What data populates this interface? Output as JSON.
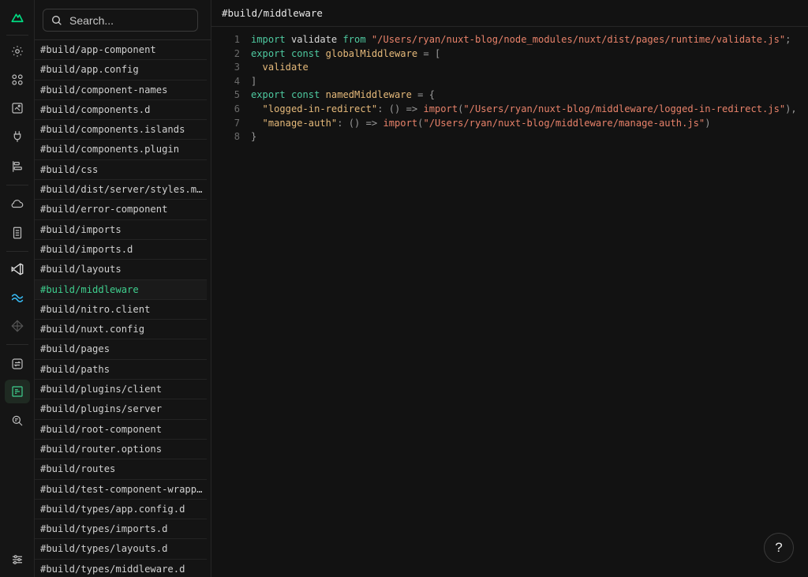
{
  "rail": {
    "icons": [
      "nuxt-logo-icon",
      "settings-icon",
      "components-icon",
      "pages-icon",
      "plugins-icon",
      "timeline-icon",
      "cloud-icon",
      "book-icon",
      "vscode-icon",
      "tailwind-icon",
      "diamond-icon",
      "transfer-icon",
      "virtual-files-icon",
      "inspect-icon",
      "sliders-icon"
    ],
    "accent": "#00dc82"
  },
  "search": {
    "placeholder": "Search..."
  },
  "files": [
    "#build/app-component",
    "#build/app.config",
    "#build/component-names",
    "#build/components.d",
    "#build/components.islands",
    "#build/components.plugin",
    "#build/css",
    "#build/dist/server/styles.mjs",
    "#build/error-component",
    "#build/imports",
    "#build/imports.d",
    "#build/layouts",
    "#build/middleware",
    "#build/nitro.client",
    "#build/nuxt.config",
    "#build/pages",
    "#build/paths",
    "#build/plugins/client",
    "#build/plugins/server",
    "#build/root-component",
    "#build/router.options",
    "#build/routes",
    "#build/test-component-wrapper",
    "#build/types/app.config.d",
    "#build/types/imports.d",
    "#build/types/layouts.d",
    "#build/types/middleware.d"
  ],
  "active_file_index": 12,
  "editor": {
    "title": "#build/middleware",
    "line_numbers": [
      "1",
      "2",
      "3",
      "4",
      "5",
      "6",
      "7",
      "8"
    ],
    "l1": {
      "k1": "import",
      "a": " validate ",
      "k2": "from",
      "s": " \"/Users/ryan/nuxt-blog/node_modules/nuxt/dist/pages/runtime/validate.js\"",
      "p": ";"
    },
    "l2": {
      "k1": "export",
      "k2": " const",
      "f": " globalMiddleware",
      "p": " = ["
    },
    "l3": {
      "i": "  validate"
    },
    "l4": {
      "p": "]"
    },
    "l5": {
      "k1": "export",
      "k2": " const",
      "f": " namedMiddleware",
      "p": " = {"
    },
    "l6": {
      "s1": "  \"logged-in-redirect\"",
      "p1": ": () => ",
      "k": "import",
      "p2": "(",
      "s2": "\"/Users/ryan/nuxt-blog/middleware/logged-in-redirect.js\"",
      "p3": "),"
    },
    "l7": {
      "s1": "  \"manage-auth\"",
      "p1": ": () => ",
      "k": "import",
      "p2": "(",
      "s2": "\"/Users/ryan/nuxt-blog/middleware/manage-auth.js\"",
      "p3": ")"
    },
    "l8": {
      "p": "}"
    }
  },
  "help": {
    "label": "?"
  }
}
